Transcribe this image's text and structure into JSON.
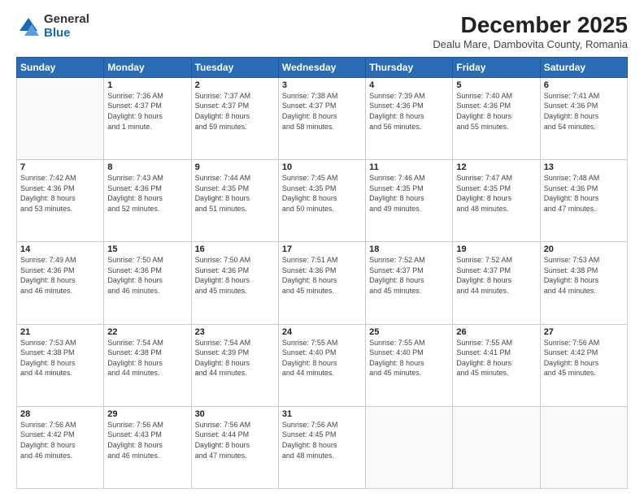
{
  "logo": {
    "general": "General",
    "blue": "Blue"
  },
  "header": {
    "month": "December 2025",
    "location": "Dealu Mare, Dambovita County, Romania"
  },
  "weekdays": [
    "Sunday",
    "Monday",
    "Tuesday",
    "Wednesday",
    "Thursday",
    "Friday",
    "Saturday"
  ],
  "weeks": [
    [
      {
        "day": "",
        "info": ""
      },
      {
        "day": "1",
        "info": "Sunrise: 7:36 AM\nSunset: 4:37 PM\nDaylight: 9 hours\nand 1 minute."
      },
      {
        "day": "2",
        "info": "Sunrise: 7:37 AM\nSunset: 4:37 PM\nDaylight: 8 hours\nand 59 minutes."
      },
      {
        "day": "3",
        "info": "Sunrise: 7:38 AM\nSunset: 4:37 PM\nDaylight: 8 hours\nand 58 minutes."
      },
      {
        "day": "4",
        "info": "Sunrise: 7:39 AM\nSunset: 4:36 PM\nDaylight: 8 hours\nand 56 minutes."
      },
      {
        "day": "5",
        "info": "Sunrise: 7:40 AM\nSunset: 4:36 PM\nDaylight: 8 hours\nand 55 minutes."
      },
      {
        "day": "6",
        "info": "Sunrise: 7:41 AM\nSunset: 4:36 PM\nDaylight: 8 hours\nand 54 minutes."
      }
    ],
    [
      {
        "day": "7",
        "info": "Sunrise: 7:42 AM\nSunset: 4:36 PM\nDaylight: 8 hours\nand 53 minutes."
      },
      {
        "day": "8",
        "info": "Sunrise: 7:43 AM\nSunset: 4:36 PM\nDaylight: 8 hours\nand 52 minutes."
      },
      {
        "day": "9",
        "info": "Sunrise: 7:44 AM\nSunset: 4:35 PM\nDaylight: 8 hours\nand 51 minutes."
      },
      {
        "day": "10",
        "info": "Sunrise: 7:45 AM\nSunset: 4:35 PM\nDaylight: 8 hours\nand 50 minutes."
      },
      {
        "day": "11",
        "info": "Sunrise: 7:46 AM\nSunset: 4:35 PM\nDaylight: 8 hours\nand 49 minutes."
      },
      {
        "day": "12",
        "info": "Sunrise: 7:47 AM\nSunset: 4:35 PM\nDaylight: 8 hours\nand 48 minutes."
      },
      {
        "day": "13",
        "info": "Sunrise: 7:48 AM\nSunset: 4:36 PM\nDaylight: 8 hours\nand 47 minutes."
      }
    ],
    [
      {
        "day": "14",
        "info": "Sunrise: 7:49 AM\nSunset: 4:36 PM\nDaylight: 8 hours\nand 46 minutes."
      },
      {
        "day": "15",
        "info": "Sunrise: 7:50 AM\nSunset: 4:36 PM\nDaylight: 8 hours\nand 46 minutes."
      },
      {
        "day": "16",
        "info": "Sunrise: 7:50 AM\nSunset: 4:36 PM\nDaylight: 8 hours\nand 45 minutes."
      },
      {
        "day": "17",
        "info": "Sunrise: 7:51 AM\nSunset: 4:36 PM\nDaylight: 8 hours\nand 45 minutes."
      },
      {
        "day": "18",
        "info": "Sunrise: 7:52 AM\nSunset: 4:37 PM\nDaylight: 8 hours\nand 45 minutes."
      },
      {
        "day": "19",
        "info": "Sunrise: 7:52 AM\nSunset: 4:37 PM\nDaylight: 8 hours\nand 44 minutes."
      },
      {
        "day": "20",
        "info": "Sunrise: 7:53 AM\nSunset: 4:38 PM\nDaylight: 8 hours\nand 44 minutes."
      }
    ],
    [
      {
        "day": "21",
        "info": "Sunrise: 7:53 AM\nSunset: 4:38 PM\nDaylight: 8 hours\nand 44 minutes."
      },
      {
        "day": "22",
        "info": "Sunrise: 7:54 AM\nSunset: 4:38 PM\nDaylight: 8 hours\nand 44 minutes."
      },
      {
        "day": "23",
        "info": "Sunrise: 7:54 AM\nSunset: 4:39 PM\nDaylight: 8 hours\nand 44 minutes."
      },
      {
        "day": "24",
        "info": "Sunrise: 7:55 AM\nSunset: 4:40 PM\nDaylight: 8 hours\nand 44 minutes."
      },
      {
        "day": "25",
        "info": "Sunrise: 7:55 AM\nSunset: 4:40 PM\nDaylight: 8 hours\nand 45 minutes."
      },
      {
        "day": "26",
        "info": "Sunrise: 7:55 AM\nSunset: 4:41 PM\nDaylight: 8 hours\nand 45 minutes."
      },
      {
        "day": "27",
        "info": "Sunrise: 7:56 AM\nSunset: 4:42 PM\nDaylight: 8 hours\nand 45 minutes."
      }
    ],
    [
      {
        "day": "28",
        "info": "Sunrise: 7:56 AM\nSunset: 4:42 PM\nDaylight: 8 hours\nand 46 minutes."
      },
      {
        "day": "29",
        "info": "Sunrise: 7:56 AM\nSunset: 4:43 PM\nDaylight: 8 hours\nand 46 minutes."
      },
      {
        "day": "30",
        "info": "Sunrise: 7:56 AM\nSunset: 4:44 PM\nDaylight: 8 hours\nand 47 minutes."
      },
      {
        "day": "31",
        "info": "Sunrise: 7:56 AM\nSunset: 4:45 PM\nDaylight: 8 hours\nand 48 minutes."
      },
      {
        "day": "",
        "info": ""
      },
      {
        "day": "",
        "info": ""
      },
      {
        "day": "",
        "info": ""
      }
    ]
  ]
}
